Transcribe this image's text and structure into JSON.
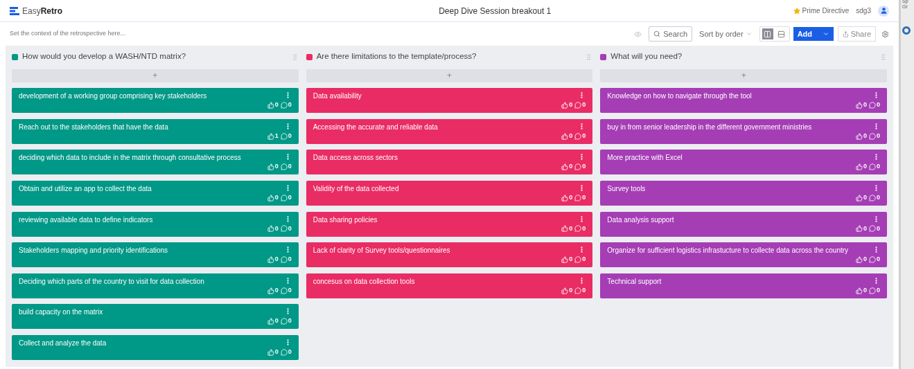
{
  "header": {
    "logo_light": "Easy",
    "logo_bold": "Retro",
    "title": "Deep Dive Session breakout 1",
    "prime_directive": "Prime Directive",
    "user": "sdg3"
  },
  "toolbar": {
    "context_placeholder": "Set the context of the retrospective here...",
    "search": "Search",
    "sort": "Sort by order",
    "views": [
      {
        "kind": "columns",
        "selected": true
      },
      {
        "kind": "rows",
        "selected": false
      }
    ],
    "add": "Add",
    "share": "Share"
  },
  "columns": [
    {
      "title": "How would you develop a WASH/NTD matrix?",
      "color": "#009886",
      "add": "+",
      "cards": [
        {
          "text": "development of a working group comprising key stakeholders",
          "votes": "0",
          "comments": "0"
        },
        {
          "text": "Reach out to the stakeholders that have the data",
          "votes": "1",
          "comments": "0"
        },
        {
          "text": "deciding which data to include in the matrix through consultative process",
          "votes": "0",
          "comments": "0"
        },
        {
          "text": "Obtain and utilize an app to collect the data",
          "votes": "0",
          "comments": "0"
        },
        {
          "text": "reviewing available data to define indicators",
          "votes": "0",
          "comments": "0"
        },
        {
          "text": "Stakeholders mapping and priority identifications",
          "votes": "0",
          "comments": "0"
        },
        {
          "text": "Deciding which parts of the country to visit for data collection",
          "votes": "0",
          "comments": "0"
        },
        {
          "text": "build capacity on the matrix",
          "votes": "0",
          "comments": "0"
        },
        {
          "text": "Collect and analyze the data",
          "votes": "0",
          "comments": "0"
        }
      ]
    },
    {
      "title": "Are there limitations to the template/process?",
      "color": "#e92c64",
      "add": "+",
      "cards": [
        {
          "text": "Data availability",
          "votes": "0",
          "comments": "0"
        },
        {
          "text": "Accessing the accurate and reliable data",
          "votes": "0",
          "comments": "0"
        },
        {
          "text": "Data access across sectors",
          "votes": "0",
          "comments": "0"
        },
        {
          "text": "Validity of the data collected",
          "votes": "0",
          "comments": "0"
        },
        {
          "text": "Data sharing policies",
          "votes": "0",
          "comments": "0"
        },
        {
          "text": "Lack of clarity of Survey tools/questionnaires",
          "votes": "0",
          "comments": "0"
        },
        {
          "text": "concesus on data collection tools",
          "votes": "0",
          "comments": "0"
        }
      ]
    },
    {
      "title": "What will you need?",
      "color": "#a53db5",
      "add": "+",
      "cards": [
        {
          "text": "Knowledge on how to navigate through the tool",
          "votes": "0",
          "comments": "0"
        },
        {
          "text": "buy in from senior leadership in the different government ministries",
          "votes": "0",
          "comments": "0"
        },
        {
          "text": "More practice with Excel",
          "votes": "0",
          "comments": "0"
        },
        {
          "text": "Survey tools",
          "votes": "0",
          "comments": "0"
        },
        {
          "text": "Data analysis support",
          "votes": "0",
          "comments": "0"
        },
        {
          "text": "Organize for sufficient logistics infrastucture to collecte data across the country",
          "votes": "0",
          "comments": "0"
        },
        {
          "text": "Technical support",
          "votes": "0",
          "comments": "0"
        }
      ]
    }
  ],
  "side_strip": {
    "line_1": "Sp",
    "line_2": "Gr"
  }
}
